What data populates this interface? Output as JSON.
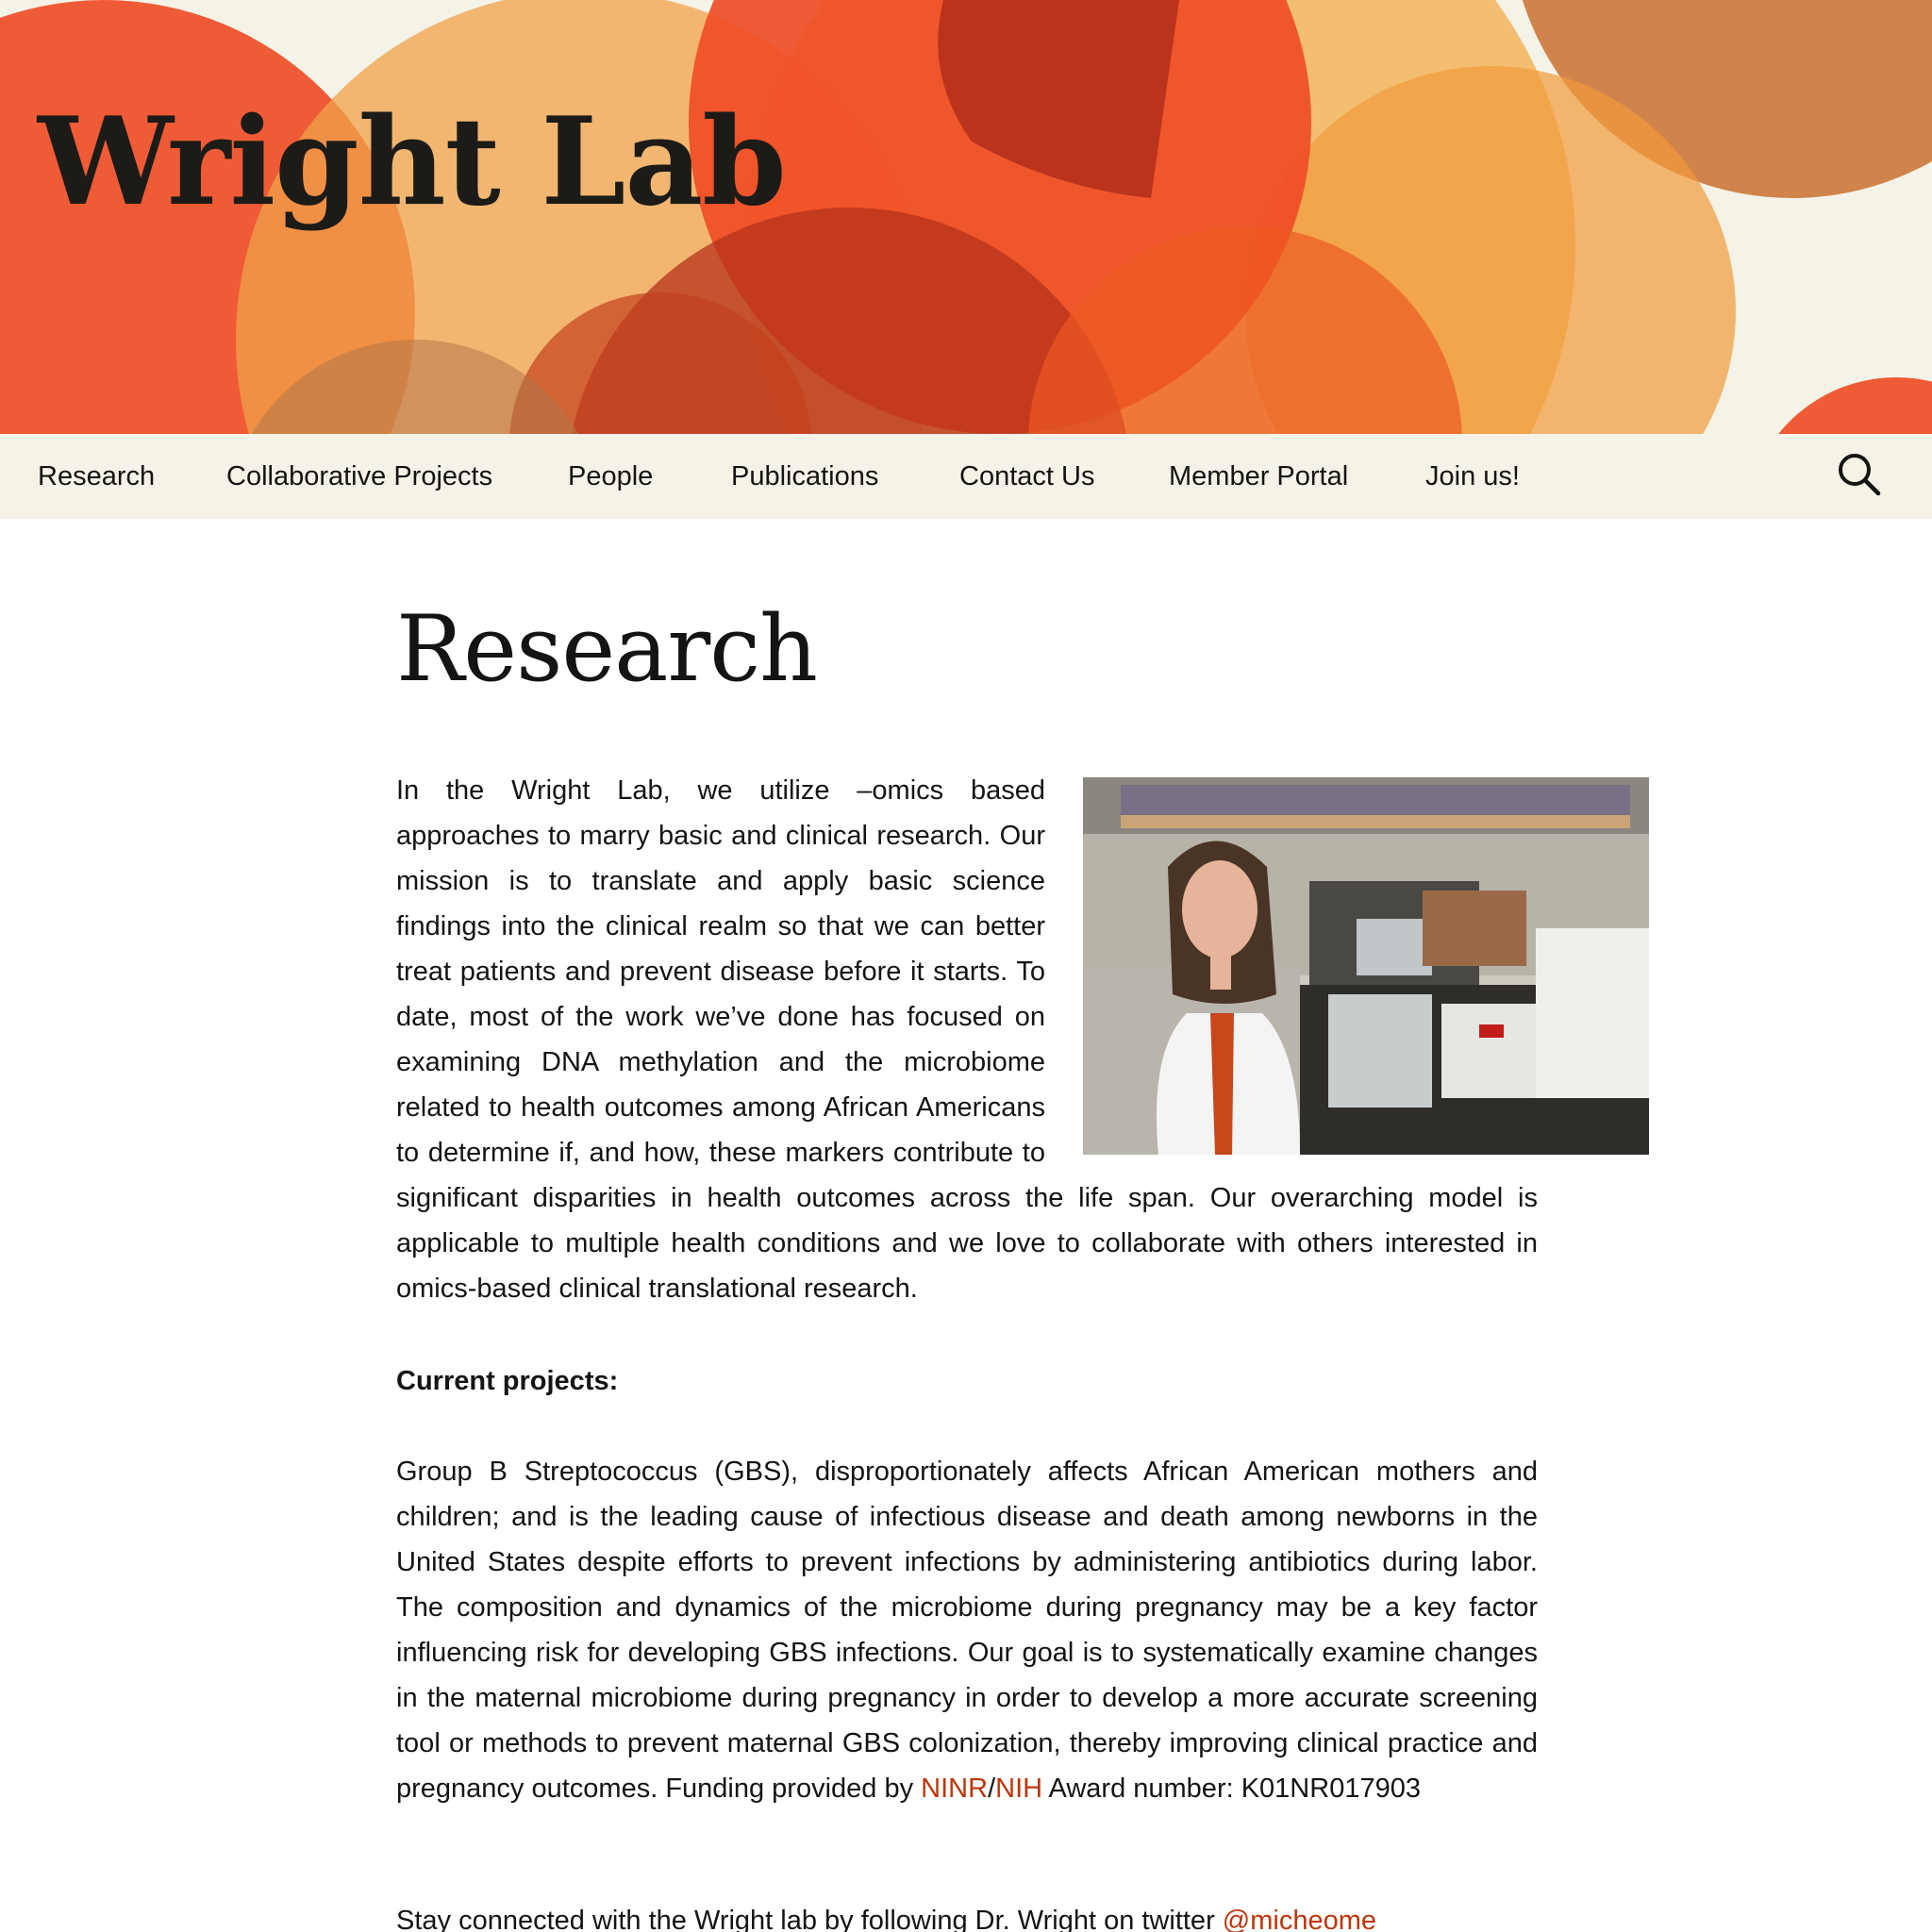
{
  "site": {
    "title": "Wright Lab"
  },
  "nav": {
    "items": [
      {
        "label": "Research"
      },
      {
        "label": "Collaborative Projects"
      },
      {
        "label": "People"
      },
      {
        "label": "Publications"
      },
      {
        "label": "Contact Us"
      },
      {
        "label": "Member Portal"
      },
      {
        "label": "Join us!"
      }
    ],
    "search_icon": "search-icon"
  },
  "main": {
    "page_title": "Research",
    "intro": "In the Wright Lab, we utilize –omics based approaches to marry basic and clinical research. Our mission is to translate and apply basic science findings into the clinical realm so that we can better treat patients and prevent disease before it starts. To date, most of the work we’ve done has focused on examining DNA methylation and the microbiome related to health outcomes among African Americans to determine if, and how, these markers contribute to significant disparities in health outcomes across the life span. Our overarching model is applicable to multiple health conditions and we love to collaborate with others interested in omics-based clinical translational research.",
    "projects_heading": "Current projects:",
    "gbs": {
      "text_before": "Group B Streptococcus (GBS), disproportionately affects African American mothers and children; and is the leading cause of infectious disease and death among newborns in the United States despite efforts to prevent infections by administering antibiotics during labor. The composition and dynamics of the microbiome during pregnancy may be a key factor influencing risk for developing GBS infections. Our goal is to systematically examine changes in the maternal microbiome during pregnancy in order to develop a more accurate screening tool or methods to prevent maternal GBS colonization, thereby improving clinical practice and pregnancy outcomes. Funding provided by ",
      "link_ninr": "NINR",
      "separator": "/",
      "link_nih": "NIH",
      "text_after": " Award number: K01NR017903"
    },
    "twitter": {
      "text": "Stay connected with the Wright lab by following Dr. Wright on twitter ",
      "handle": "@micheome"
    }
  },
  "colors": {
    "nav_background": "#f5f3e8",
    "link": "#bc360a",
    "text": "#141412"
  }
}
